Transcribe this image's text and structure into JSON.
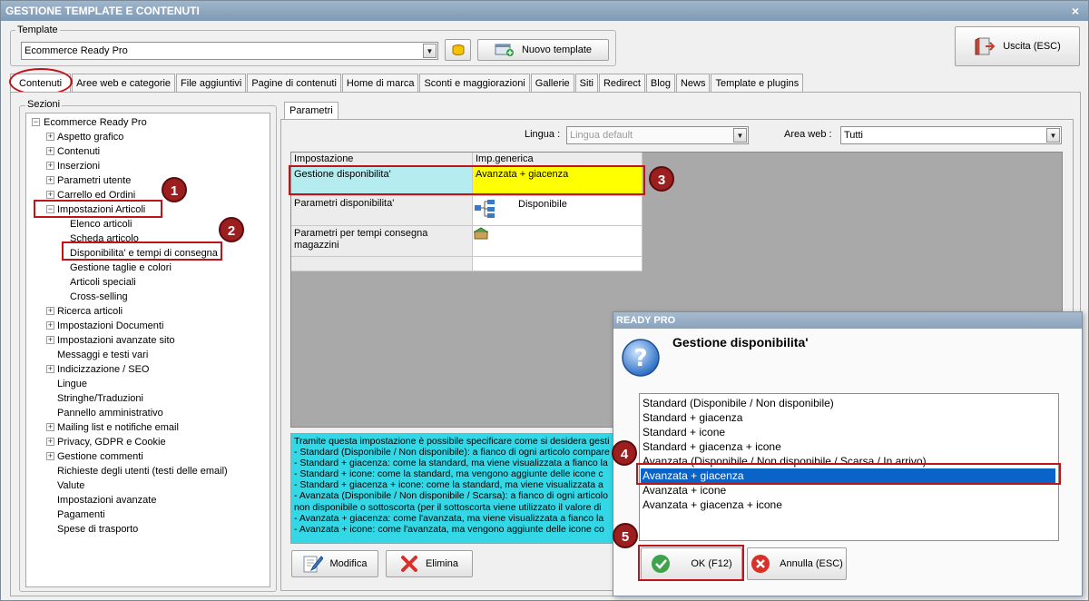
{
  "window": {
    "title": "GESTIONE TEMPLATE E CONTENUTI",
    "close_label": "×"
  },
  "template_group": {
    "label": "Template",
    "selected": "Ecommerce Ready Pro",
    "new_template_button": "Nuovo template"
  },
  "exit_button": "Uscita (ESC)",
  "tabs": [
    {
      "label": "Contenuti",
      "active": true
    },
    {
      "label": "Aree web e categorie"
    },
    {
      "label": "File aggiuntivi"
    },
    {
      "label": "Pagine di contenuti"
    },
    {
      "label": "Home di marca"
    },
    {
      "label": "Sconti e maggiorazioni"
    },
    {
      "label": "Gallerie"
    },
    {
      "label": "Siti"
    },
    {
      "label": "Redirect"
    },
    {
      "label": "Blog"
    },
    {
      "label": "News"
    },
    {
      "label": "Template e plugins"
    }
  ],
  "sections": {
    "label": "Sezioni",
    "root": "Ecommerce Ready Pro",
    "items": [
      {
        "label": "Aspetto grafico",
        "expand": "+"
      },
      {
        "label": "Contenuti",
        "expand": "+"
      },
      {
        "label": "Inserzioni",
        "expand": "+"
      },
      {
        "label": "Parametri utente",
        "expand": "+"
      },
      {
        "label": "Carrello ed Ordini",
        "expand": "+"
      },
      {
        "label": "Impostazioni Articoli",
        "expand": "−"
      },
      {
        "label": "Elenco articoli",
        "child": true
      },
      {
        "label": "Scheda articolo",
        "child": true
      },
      {
        "label": "Disponibilita' e tempi di consegna",
        "child": true
      },
      {
        "label": "Gestione taglie e colori",
        "child": true
      },
      {
        "label": "Articoli speciali",
        "child": true
      },
      {
        "label": "Cross-selling",
        "child": true
      },
      {
        "label": "Ricerca articoli",
        "expand": "+"
      },
      {
        "label": "Impostazioni Documenti",
        "expand": "+"
      },
      {
        "label": "Impostazioni avanzate sito",
        "expand": "+"
      },
      {
        "label": "Messaggi e testi vari"
      },
      {
        "label": "Indicizzazione / SEO",
        "expand": "+"
      },
      {
        "label": "Lingue"
      },
      {
        "label": "Stringhe/Traduzioni"
      },
      {
        "label": "Pannello amministrativo"
      },
      {
        "label": "Mailing list e notifiche email",
        "expand": "+"
      },
      {
        "label": "Privacy, GDPR e Cookie",
        "expand": "+"
      },
      {
        "label": "Gestione commenti",
        "expand": "+"
      },
      {
        "label": "Richieste degli utenti (testi delle email)"
      },
      {
        "label": "Valute"
      },
      {
        "label": "Impostazioni avanzate"
      },
      {
        "label": "Pagamenti"
      },
      {
        "label": "Spese di trasporto"
      }
    ]
  },
  "params": {
    "tab_label": "Parametri",
    "lingua_label": "Lingua :",
    "lingua_value": "Lingua default",
    "area_label": "Area web :",
    "area_value": "Tutti",
    "col_setting": "Impostazione",
    "col_generic": "Imp.generica",
    "rows": [
      {
        "setting": "Gestione disponibilita'",
        "value": "Avanzata + giacenza"
      },
      {
        "setting": "Parametri disponibilita'",
        "value": "Disponibile"
      },
      {
        "setting": "Parametri per tempi consegna magazzini",
        "value": ""
      }
    ],
    "description": [
      "Tramite questa impostazione è possibile specificare come si desidera gesti",
      "- Standard (Disponibile / Non disponibile): a fianco di ogni articolo compare",
      "- Standard + giacenza: come la standard, ma viene visualizzata a fianco la",
      "- Standard + icone: come la standard, ma vengono aggiunte delle icone c",
      "- Standard + giacenza + icone: come la standard, ma viene visualizzata a",
      "- Avanzata (Disponibile / Non disponibile / Scarsa): a fianco di ogni articolo",
      "non disponibile o sottoscorta (per il sottoscorta viene utilizzato il valore di",
      "- Avanzata + giacenza: come l'avanzata, ma viene visualizzata a fianco la",
      "- Avanzata + icone: come l'avanzata, ma vengono aggiunte delle icone co"
    ],
    "edit_button": "Modifica",
    "delete_button": "Elimina"
  },
  "dialog": {
    "title": "READY PRO",
    "heading": "Gestione disponibilita'",
    "options": [
      "Standard (Disponibile / Non disponibile)",
      "Standard + giacenza",
      "Standard + icone",
      "Standard + giacenza + icone",
      "Avanzata (Disponibile / Non disponibile / Scarsa / In arrivo)",
      "Avanzata + giacenza",
      "Avanzata + icone",
      "Avanzata + giacenza + icone"
    ],
    "selected_index": 5,
    "ok_button": "OK (F12)",
    "cancel_button": "Annulla (ESC)"
  },
  "markers": [
    "1",
    "2",
    "3",
    "4",
    "5"
  ],
  "colors": {
    "highlight_cyan": "#b4ecf0",
    "highlight_yellow": "#ffff00",
    "selection_blue": "#0a64c8",
    "marker_red": "#9c1e1e",
    "annotation_red": "#c0141a"
  }
}
